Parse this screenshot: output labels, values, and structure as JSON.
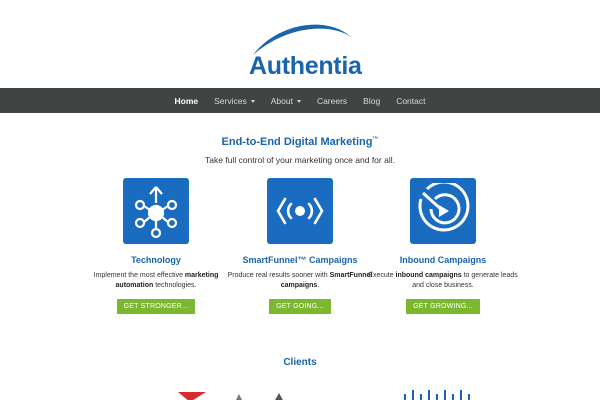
{
  "brand": {
    "name": "Authentia",
    "color": "#1a64ad"
  },
  "nav": {
    "items": [
      {
        "label": "Home",
        "active": true,
        "dropdown": false
      },
      {
        "label": "Services",
        "active": false,
        "dropdown": true
      },
      {
        "label": "About",
        "active": false,
        "dropdown": true
      },
      {
        "label": "Careers",
        "active": false,
        "dropdown": false
      },
      {
        "label": "Blog",
        "active": false,
        "dropdown": false
      },
      {
        "label": "Contact",
        "active": false,
        "dropdown": false
      }
    ],
    "background": "#404442"
  },
  "hero": {
    "headline": "End-to-End Digital Marketing",
    "headline_mark": "™",
    "tagline": "Take full control of your marketing once and for all."
  },
  "features": [
    {
      "icon": "network-nodes-icon",
      "title": "Technology",
      "desc_a": "Implement the most effective ",
      "desc_bold": "marketing automation",
      "desc_b": " technologies.",
      "cta": "GET STRONGER..."
    },
    {
      "icon": "broadcast-signal-icon",
      "title": "SmartFunnel™ Campaigns",
      "desc_a": "Produce real results sooner with ",
      "desc_bold": "SmartFunnel campaigns",
      "desc_b": ".",
      "cta": "GET GOING..."
    },
    {
      "icon": "target-play-icon",
      "title": "Inbound Campaigns",
      "desc_a": "Execute ",
      "desc_bold": "inbound campaigns",
      "desc_b": " to generate leads and close business.",
      "cta": "GET GROWING..."
    }
  ],
  "clients": {
    "title": "Clients"
  },
  "colors": {
    "accent": "#1a6cc0",
    "cta": "#7cb82f"
  }
}
